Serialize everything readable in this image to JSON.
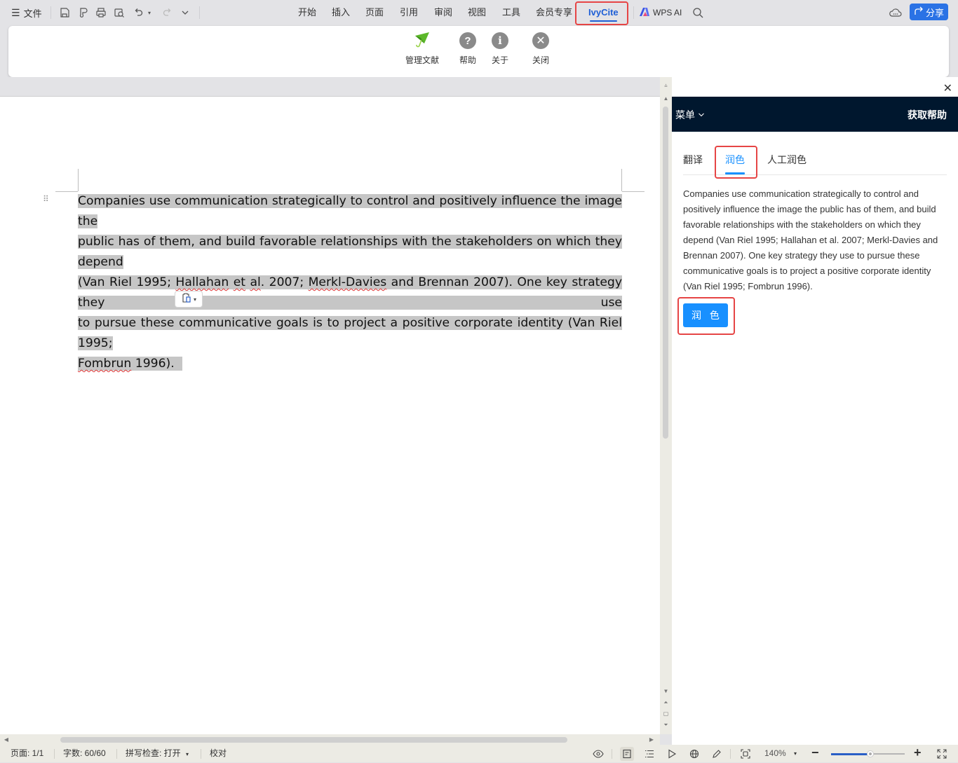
{
  "topbar": {
    "menu_label": "文件",
    "tabs": [
      {
        "label": "开始"
      },
      {
        "label": "插入"
      },
      {
        "label": "页面"
      },
      {
        "label": "引用"
      },
      {
        "label": "审阅"
      },
      {
        "label": "视图"
      },
      {
        "label": "工具"
      },
      {
        "label": "会员专享"
      },
      {
        "label": "IvyCite",
        "active": true
      }
    ],
    "wps_ai_label": "WPS AI",
    "share_label": "分享"
  },
  "ribbon": {
    "buttons": [
      {
        "label": "管理文献",
        "icon": "umbrella-icon"
      },
      {
        "label": "帮助",
        "icon": "help-icon"
      },
      {
        "label": "关于",
        "icon": "info-icon"
      },
      {
        "label": "关闭",
        "icon": "close-icon"
      }
    ]
  },
  "document": {
    "paragraph_lines": [
      "Companies use communication strategically to control and positively influence the image the",
      "public has of them, and build favorable relationships with the stakeholders on which they depend",
      "(Van Riel 1995; ",
      "Hallahan",
      " ",
      "et",
      " ",
      "al",
      ". 2007; ",
      "Merkl-Davies",
      " and Brennan 2007). One key strategy they use",
      "to pursue these communicative goals is to project a positive corporate identity (Van Riel 1995;",
      "Fombrun",
      " 1996)."
    ]
  },
  "panel": {
    "menu_label": "菜单",
    "help_label": "获取帮助",
    "tabs": [
      {
        "label": "翻译"
      },
      {
        "label": "润色",
        "active": true
      },
      {
        "label": "人工润色"
      }
    ],
    "text": "Companies use communication strategically to control and positively influence the image the public has of them, and build favorable relationships with the stakeholders on which they depend (Van Riel 1995; Hallahan et al. 2007; Merkl-Davies and Brennan 2007). One key strategy they use to pursue these communicative goals is to project a positive corporate identity (Van Riel 1995; Fombrun 1996).",
    "polish_button": "润 色"
  },
  "statusbar": {
    "page": "页面: 1/1",
    "word_count": "字数: 60/60",
    "spell_check": "拼写检查: 打开",
    "proofread": "校对",
    "zoom_level": "140%",
    "zoom_slider_fraction": 0.53
  },
  "colors": {
    "accent_blue": "#1890ff",
    "active_tab_blue": "#1e5fd6",
    "share_blue": "#2a72e5",
    "panel_header": "#00172e",
    "highlight_red": "#e64545",
    "selection_gray": "#c6c6c6"
  }
}
